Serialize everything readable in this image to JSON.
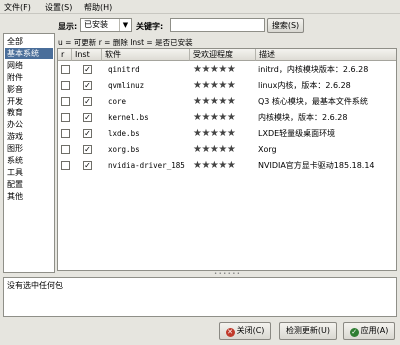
{
  "menubar": {
    "file": "文件(F)",
    "settings": "设置(S)",
    "help": "帮助(H)"
  },
  "toolbar": {
    "show_label": "显示:",
    "filter_value": "已安装",
    "keyword_label": "关键字:",
    "search_value": "",
    "search_button": "搜索(S)"
  },
  "legend": "u = 可更新    r = 删除    Inst = 是否已安装",
  "categories": [
    "全部",
    "基本系统",
    "网络",
    "附件",
    "影音",
    "开发",
    "教育",
    "办公",
    "游戏",
    "图形",
    "系统",
    "工具",
    "配置",
    "其他"
  ],
  "selected_category": "基本系统",
  "table": {
    "columns": [
      "r",
      "Inst",
      "软件",
      "受欢迎程度",
      "描述"
    ],
    "rows": [
      {
        "r": false,
        "inst": true,
        "name": "qinitrd",
        "stars": "★★★★★",
        "rating": 5,
        "desc": "initrd，内核模块版本：2.6.28"
      },
      {
        "r": false,
        "inst": true,
        "name": "qvmlinuz",
        "stars": "★★★★★",
        "rating": 5,
        "desc": "linux内核，版本：2.6.28"
      },
      {
        "r": false,
        "inst": true,
        "name": "core",
        "stars": "★★★★★",
        "rating": 5,
        "desc": "Q3 核心模块，最基本文件系统"
      },
      {
        "r": false,
        "inst": true,
        "name": "kernel.bs",
        "stars": "★★★★★",
        "rating": 5,
        "desc": "内核模块，版本：2.6.28"
      },
      {
        "r": false,
        "inst": true,
        "name": "lxde.bs",
        "stars": "★★★★★",
        "rating": 5,
        "desc": "LXDE轻量级桌面环境"
      },
      {
        "r": false,
        "inst": true,
        "name": "xorg.bs",
        "stars": "★★★★★",
        "rating": 5,
        "desc": "Xorg"
      },
      {
        "r": false,
        "inst": true,
        "name": "nvidia-driver_185",
        "stars": "★★★★★",
        "rating": 5,
        "desc": "NVIDIA官方显卡驱动185.18.14"
      }
    ]
  },
  "description_text": "没有选中任何包",
  "buttons": {
    "close": "关闭(C)",
    "check_update": "检测更新(U)",
    "apply": "应用(A)"
  },
  "icons": {
    "close": "close-icon",
    "apply": "apply-icon"
  },
  "colors": {
    "selection": "#4a6e9a",
    "close_icon": "#c0392b",
    "apply_icon": "#2e7d32"
  }
}
